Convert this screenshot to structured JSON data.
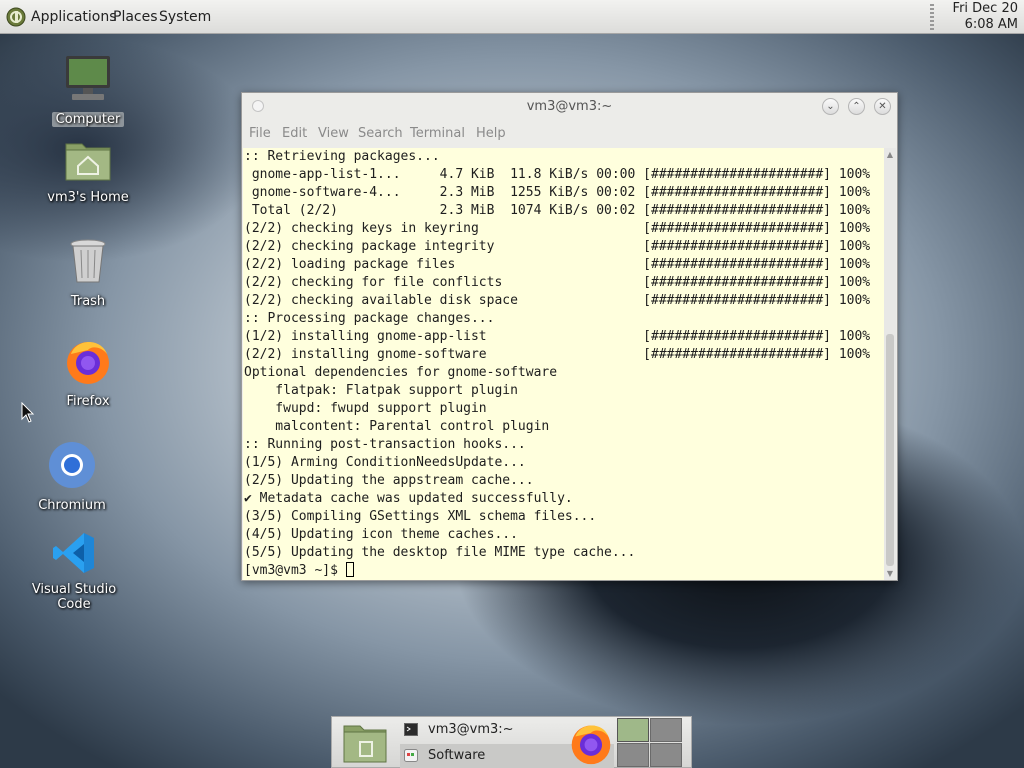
{
  "top_panel": {
    "menus": [
      "Applications",
      "Places",
      "System"
    ],
    "clock_date": "Fri Dec 20",
    "clock_time": "6:08 AM"
  },
  "desktop_icons": [
    {
      "label": "Computer",
      "icon": "computer-icon"
    },
    {
      "label": "vm3's Home",
      "icon": "home-folder-icon"
    },
    {
      "label": "Trash",
      "icon": "trash-icon"
    },
    {
      "label": "Firefox",
      "icon": "firefox-icon"
    },
    {
      "label": "Chromium",
      "icon": "chromium-icon"
    },
    {
      "label": "Visual Studio Code",
      "icon": "vscode-icon"
    }
  ],
  "terminal": {
    "title": "vm3@vm3:~",
    "menu": [
      "File",
      "Edit",
      "View",
      "Search",
      "Terminal",
      "Help"
    ],
    "lines": [
      ":: Retrieving packages...",
      " gnome-app-list-1...     4.7 KiB  11.8 KiB/s 00:00 [######################] 100%",
      " gnome-software-4...     2.3 MiB  1255 KiB/s 00:02 [######################] 100%",
      " Total (2/2)             2.3 MiB  1074 KiB/s 00:02 [######################] 100%",
      "(2/2) checking keys in keyring                     [######################] 100%",
      "(2/2) checking package integrity                   [######################] 100%",
      "(2/2) loading package files                        [######################] 100%",
      "(2/2) checking for file conflicts                  [######################] 100%",
      "(2/2) checking available disk space                [######################] 100%",
      ":: Processing package changes...",
      "(1/2) installing gnome-app-list                    [######################] 100%",
      "(2/2) installing gnome-software                    [######################] 100%",
      "Optional dependencies for gnome-software",
      "    flatpak: Flatpak support plugin",
      "    fwupd: fwupd support plugin",
      "    malcontent: Parental control plugin",
      ":: Running post-transaction hooks...",
      "(1/5) Arming ConditionNeedsUpdate...",
      "(2/5) Updating the appstream cache...",
      "✔ Metadata cache was updated successfully.",
      "(3/5) Compiling GSettings XML schema files...",
      "(4/5) Updating icon theme caches...",
      "(5/5) Updating the desktop file MIME type cache..."
    ],
    "prompt": "[vm3@vm3 ~]$ "
  },
  "bottom_panel": {
    "tasks": [
      {
        "label": "vm3@vm3:~",
        "icon": "terminal-icon"
      },
      {
        "label": "Software",
        "icon": "software-icon"
      }
    ]
  }
}
